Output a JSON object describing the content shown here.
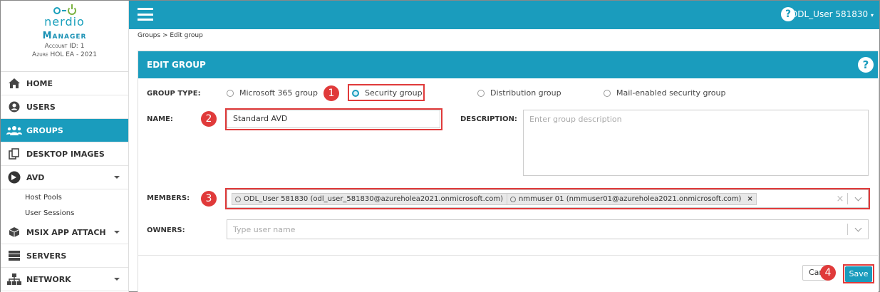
{
  "brand": {
    "name": "nerdio",
    "product": "Manager",
    "account": "Account ID: 1",
    "tenant": "Azure HOL EA - 2021"
  },
  "nav": {
    "home": "HOME",
    "users": "USERS",
    "groups": "GROUPS",
    "desktop_images": "DESKTOP IMAGES",
    "avd": "AVD",
    "host_pools": "Host Pools",
    "user_sessions": "User Sessions",
    "msix": "MSIX APP ATTACH",
    "servers": "SERVERS",
    "network": "NETWORK"
  },
  "topbar": {
    "help": "?",
    "user": "ODL_User 581830"
  },
  "breadcrumb": "Groups > Edit group",
  "panel": {
    "title": "EDIT GROUP",
    "help": "?"
  },
  "form": {
    "group_type_label": "GROUP TYPE:",
    "group_types": [
      "Microsoft 365 group",
      "Security group",
      "Distribution group",
      "Mail-enabled security group"
    ],
    "selected_group_type": "Security group",
    "name_label": "NAME:",
    "name_value": "Standard AVD",
    "description_label": "DESCRIPTION:",
    "description_placeholder": "Enter group description",
    "members_label": "MEMBERS:",
    "members": [
      "ODL_User 581830 (odl_user_581830@azureholea2021.onmicrosoft.com)",
      "nmmuser 01 (nmmuser01@azureholea2021.onmicrosoft.com)"
    ],
    "owners_label": "OWNERS:",
    "owners_placeholder": "Type user name",
    "cancel_label": "Cancel",
    "save_label": "Save"
  },
  "steps": [
    "1",
    "2",
    "3",
    "4"
  ],
  "colors": {
    "accent": "#1a9cbd",
    "highlight": "#e03a3a"
  }
}
